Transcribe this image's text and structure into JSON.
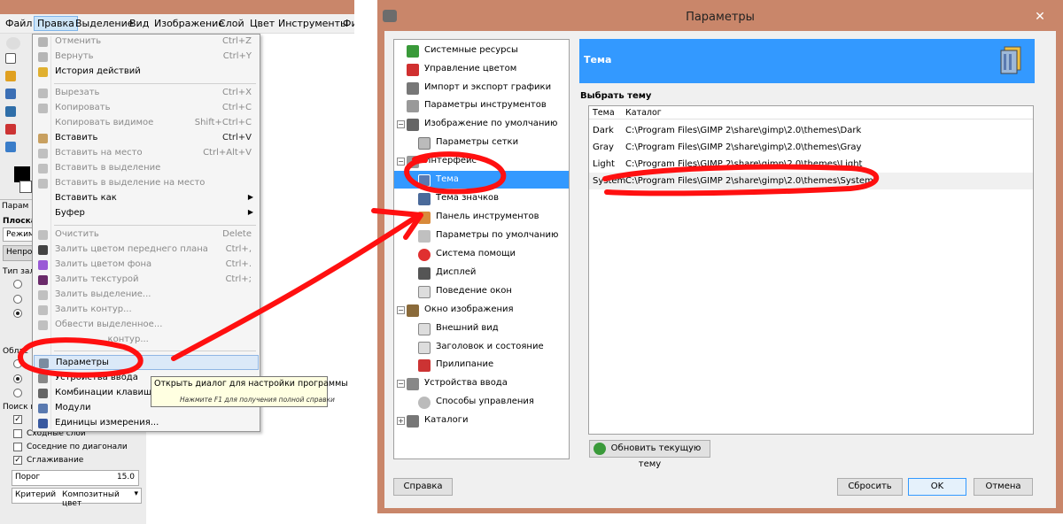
{
  "gimp": {
    "menubar": [
      "Файл",
      "Правка",
      "Выделение",
      "Вид",
      "Изображение",
      "Слой",
      "Цвет",
      "Инструменты",
      "Фи"
    ],
    "edit_menu": [
      {
        "label": "Отменить",
        "shortcut": "Ctrl+Z",
        "disabled": true
      },
      {
        "label": "Вернуть",
        "shortcut": "Ctrl+Y",
        "disabled": true
      },
      {
        "label": "История действий",
        "shortcut": "",
        "disabled": false
      },
      {
        "label": "Вырезать",
        "shortcut": "Ctrl+X",
        "disabled": true
      },
      {
        "label": "Копировать",
        "shortcut": "Ctrl+C",
        "disabled": true
      },
      {
        "label": "Копировать видимое",
        "shortcut": "Shift+Ctrl+C",
        "disabled": true
      },
      {
        "label": "Вставить",
        "shortcut": "Ctrl+V",
        "disabled": false
      },
      {
        "label": "Вставить на место",
        "shortcut": "Ctrl+Alt+V",
        "disabled": true
      },
      {
        "label": "Вставить в выделение",
        "shortcut": "",
        "disabled": true
      },
      {
        "label": "Вставить в выделение на место",
        "shortcut": "",
        "disabled": true
      },
      {
        "label": "Вставить как",
        "shortcut": "",
        "disabled": false
      },
      {
        "label": "Буфер",
        "shortcut": "",
        "disabled": false
      },
      {
        "label": "Очистить",
        "shortcut": "Delete",
        "disabled": true
      },
      {
        "label": "Залить цветом переднего плана",
        "shortcut": "Ctrl+,",
        "disabled": true
      },
      {
        "label": "Залить цветом фона",
        "shortcut": "Ctrl+.",
        "disabled": true
      },
      {
        "label": "Залить текстурой",
        "shortcut": "Ctrl+;",
        "disabled": true
      },
      {
        "label": "Залить выделение...",
        "shortcut": "",
        "disabled": true
      },
      {
        "label": "Залить контур...",
        "shortcut": "",
        "disabled": true
      },
      {
        "label": "Обвести выделенное...",
        "shortcut": "",
        "disabled": true
      },
      {
        "label": "...контур...",
        "shortcut": "",
        "disabled": true
      },
      {
        "label": "Параметры",
        "shortcut": "",
        "disabled": false
      },
      {
        "label": "Устройства ввода",
        "shortcut": "",
        "disabled": false
      },
      {
        "label": "Комбинации клавиш",
        "shortcut": "",
        "disabled": false
      },
      {
        "label": "Модули",
        "shortcut": "",
        "disabled": false
      },
      {
        "label": "Единицы измерения...",
        "shortcut": "",
        "disabled": false
      }
    ],
    "tooltip": {
      "main": "Открыть диалог для настройки программы",
      "hint": "Нажмите F1 для получения полной справки"
    },
    "tool_options": {
      "tab": "Парам",
      "title": "Плоская",
      "mode": "Режим",
      "opacity": "Непрозр",
      "fill_type": "Тип зали",
      "area": "Облас",
      "search": "Поиск п",
      "similar": "Сходные слои",
      "diagonal": "Соседние по диагонали",
      "antialias": "Сглаживание",
      "threshold_label": "Порог",
      "threshold_value": "15.0",
      "criterion_label": "Критерий",
      "criterion_value": "Композитный цвет"
    }
  },
  "prefs": {
    "title": "Параметры",
    "close": "✕",
    "tree": [
      {
        "label": "Системные ресурсы",
        "level": 0
      },
      {
        "label": "Управление цветом",
        "level": 0
      },
      {
        "label": "Импорт и экспорт графики",
        "level": 0
      },
      {
        "label": "Параметры инструментов",
        "level": 0
      },
      {
        "label": "Изображение по умолчанию",
        "level": 0,
        "expander": "⊟"
      },
      {
        "label": "Параметры сетки",
        "level": 1
      },
      {
        "label": "Интерфейс",
        "level": 0,
        "expander": "⊟"
      },
      {
        "label": "Тема",
        "level": 1
      },
      {
        "label": "Тема значков",
        "level": 1
      },
      {
        "label": "Панель инструментов",
        "level": 1
      },
      {
        "label": "Параметры по умолчанию",
        "level": 1
      },
      {
        "label": "Система помощи",
        "level": 1
      },
      {
        "label": "Дисплей",
        "level": 1
      },
      {
        "label": "Поведение окон",
        "level": 1
      },
      {
        "label": "Окно изображения",
        "level": 0,
        "expander": "⊟"
      },
      {
        "label": "Внешний вид",
        "level": 1
      },
      {
        "label": "Заголовок и состояние",
        "level": 1
      },
      {
        "label": "Прилипание",
        "level": 1
      },
      {
        "label": "Устройства ввода",
        "level": 0,
        "expander": "⊟"
      },
      {
        "label": "Способы управления",
        "level": 1
      },
      {
        "label": "Каталоги",
        "level": 0,
        "expander": "⊞"
      }
    ],
    "banner_title": "Тема",
    "select_theme_label": "Выбрать тему",
    "table": {
      "headers": [
        "Тема",
        "Каталог"
      ],
      "rows": [
        [
          "Dark",
          "C:\\Program Files\\GIMP 2\\share\\gimp\\2.0\\themes\\Dark"
        ],
        [
          "Gray",
          "C:\\Program Files\\GIMP 2\\share\\gimp\\2.0\\themes\\Gray"
        ],
        [
          "Light",
          "C:\\Program Files\\GIMP 2\\share\\gimp\\2.0\\themes\\Light"
        ],
        [
          "System",
          "C:\\Program Files\\GIMP 2\\share\\gimp\\2.0\\themes\\System"
        ]
      ]
    },
    "refresh_button": "Обновить текущую тему",
    "help_button": "Справка",
    "reset_button": "Сбросить",
    "ok_button": "OK",
    "cancel_button": "Отмена"
  },
  "colors": {
    "selection": "#3399ff",
    "annotation": "#ff0000",
    "titlebar": "#c9866a"
  }
}
